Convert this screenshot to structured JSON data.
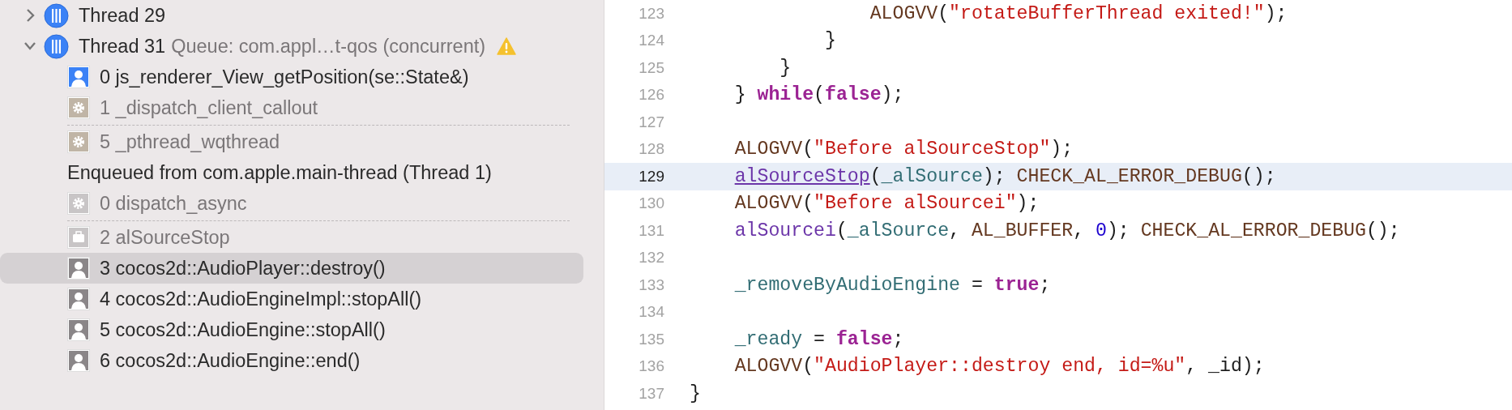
{
  "debug_navigator": {
    "threads": [
      {
        "label": "Thread 29",
        "expanded": false
      },
      {
        "label": "Thread 31",
        "queue": "Queue: com.appl…t-qos (concurrent)",
        "expanded": true,
        "warning": true,
        "items": [
          {
            "kind": "user",
            "text": "0 js_renderer_View_getPosition(se::State&)",
            "selected": false
          },
          {
            "kind": "system",
            "text": "1 _dispatch_client_callout",
            "selected": false
          },
          {
            "kind": "separator"
          },
          {
            "kind": "system",
            "text": "5 _pthread_wqthread",
            "selected": false
          },
          {
            "kind": "enqueued",
            "text": "Enqueued from com.apple.main-thread (Thread 1)"
          },
          {
            "kind": "async",
            "text": "0 dispatch_async",
            "selected": false
          },
          {
            "kind": "separator"
          },
          {
            "kind": "library",
            "text": "2 alSourceStop",
            "selected": false
          },
          {
            "kind": "caller",
            "text": "3 cocos2d::AudioPlayer::destroy()",
            "selected": true
          },
          {
            "kind": "caller",
            "text": "4 cocos2d::AudioEngineImpl::stopAll()",
            "selected": false
          },
          {
            "kind": "caller",
            "text": "5 cocos2d::AudioEngine::stopAll()",
            "selected": false
          },
          {
            "kind": "caller",
            "text": "6 cocos2d::AudioEngine::end()",
            "selected": false
          }
        ]
      }
    ]
  },
  "editor": {
    "lines": [
      {
        "number": "123",
        "current": false,
        "tokens": [
          {
            "t": "                ALOGVV",
            "kind": "macro"
          },
          {
            "t": "(",
            "kind": "plain"
          },
          {
            "t": "\"rotateBufferThread exited!\"",
            "kind": "string"
          },
          {
            "t": ");",
            "kind": "plain"
          }
        ]
      },
      {
        "number": "124",
        "current": false,
        "tokens": [
          {
            "t": "            }",
            "kind": "plain"
          }
        ]
      },
      {
        "number": "125",
        "current": false,
        "tokens": [
          {
            "t": "        }",
            "kind": "plain"
          }
        ]
      },
      {
        "number": "126",
        "current": false,
        "tokens": [
          {
            "t": "    } ",
            "kind": "plain"
          },
          {
            "t": "while",
            "kind": "keyword"
          },
          {
            "t": "(",
            "kind": "plain"
          },
          {
            "t": "false",
            "kind": "keyword"
          },
          {
            "t": ");",
            "kind": "plain"
          }
        ]
      },
      {
        "number": "127",
        "current": false
      },
      {
        "number": "128",
        "current": false,
        "tokens": [
          {
            "t": "    ALOGVV",
            "kind": "macro"
          },
          {
            "t": "(",
            "kind": "plain"
          },
          {
            "t": "\"Before alSourceStop\"",
            "kind": "string"
          },
          {
            "t": ");",
            "kind": "plain"
          }
        ]
      },
      {
        "number": "129",
        "current": true,
        "tokens": [
          {
            "t": "    alSourceStop",
            "kind": "link"
          },
          {
            "t": "(",
            "kind": "plain"
          },
          {
            "t": "_alSource",
            "kind": "variable"
          },
          {
            "t": "); ",
            "kind": "plain"
          },
          {
            "t": "CHECK_AL_ERROR_DEBUG",
            "kind": "macro"
          },
          {
            "t": "();",
            "kind": "plain"
          }
        ]
      },
      {
        "number": "130",
        "current": false,
        "tokens": [
          {
            "t": "    ALOGVV",
            "kind": "macro"
          },
          {
            "t": "(",
            "kind": "plain"
          },
          {
            "t": "\"Before alSourcei\"",
            "kind": "string"
          },
          {
            "t": ");",
            "kind": "plain"
          }
        ]
      },
      {
        "number": "131",
        "current": false,
        "tokens": [
          {
            "t": "    alSourcei",
            "kind": "function"
          },
          {
            "t": "(",
            "kind": "plain"
          },
          {
            "t": "_alSource",
            "kind": "variable"
          },
          {
            "t": ", ",
            "kind": "plain"
          },
          {
            "t": "AL_BUFFER",
            "kind": "macro"
          },
          {
            "t": ", ",
            "kind": "plain"
          },
          {
            "t": "0",
            "kind": "number"
          },
          {
            "t": "); ",
            "kind": "plain"
          },
          {
            "t": "CHECK_AL_ERROR_DEBUG",
            "kind": "macro"
          },
          {
            "t": "();",
            "kind": "plain"
          }
        ]
      },
      {
        "number": "132",
        "current": false
      },
      {
        "number": "133",
        "current": false,
        "tokens": [
          {
            "t": "    _removeByAudioEngine",
            "kind": "variable"
          },
          {
            "t": " = ",
            "kind": "plain"
          },
          {
            "t": "true",
            "kind": "keyword"
          },
          {
            "t": ";",
            "kind": "plain"
          }
        ]
      },
      {
        "number": "134",
        "current": false
      },
      {
        "number": "135",
        "current": false,
        "tokens": [
          {
            "t": "    _ready",
            "kind": "variable"
          },
          {
            "t": " = ",
            "kind": "plain"
          },
          {
            "t": "false",
            "kind": "keyword"
          },
          {
            "t": ";",
            "kind": "plain"
          }
        ]
      },
      {
        "number": "136",
        "current": false,
        "tokens": [
          {
            "t": "    ALOGVV",
            "kind": "macro"
          },
          {
            "t": "(",
            "kind": "plain"
          },
          {
            "t": "\"AudioPlayer::destroy end, id=%u\"",
            "kind": "string"
          },
          {
            "t": ", _id);",
            "kind": "plain"
          }
        ]
      },
      {
        "number": "137",
        "current": false,
        "tokens": [
          {
            "t": "}",
            "kind": "plain"
          }
        ]
      }
    ]
  }
}
